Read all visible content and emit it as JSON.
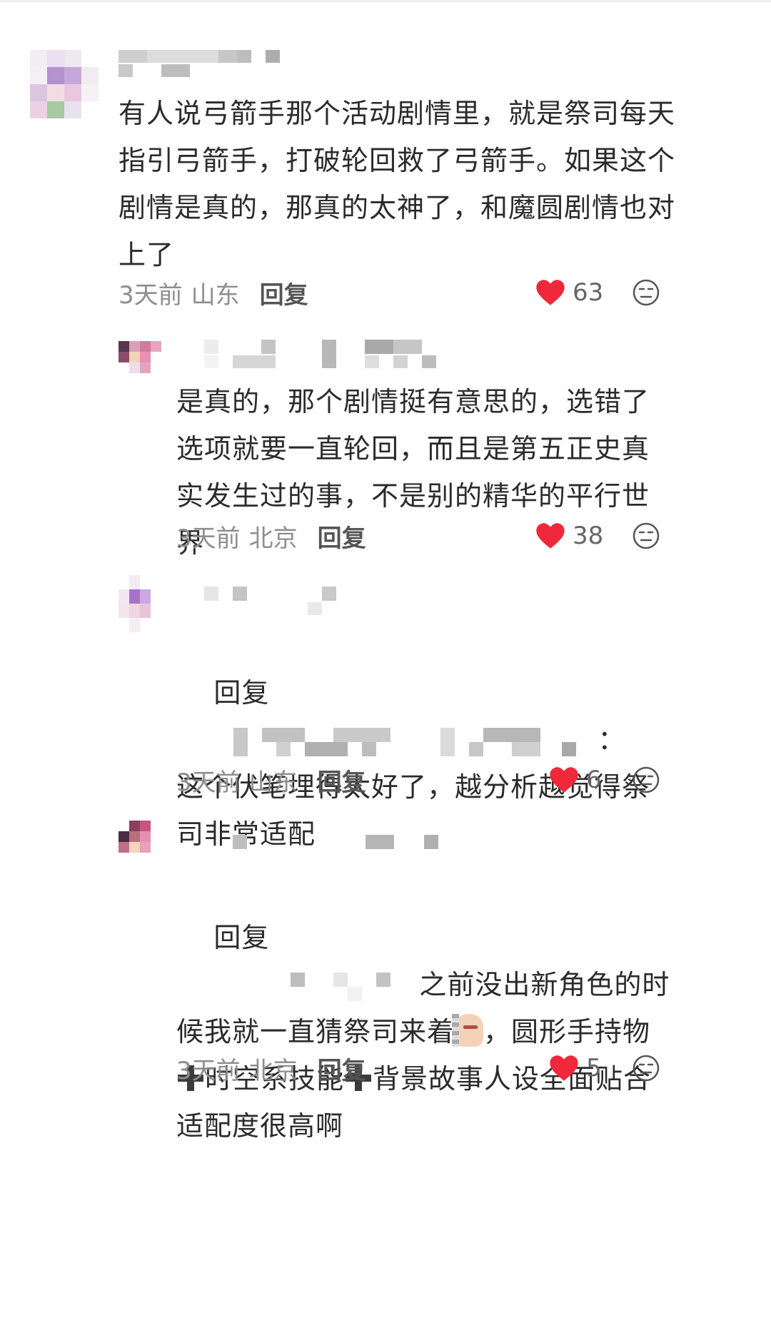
{
  "comments": [
    {
      "text": "有人说弓箭手那个活动剧情里，就是祭司每天指引弓箭手，打破轮回救了弓箭手。如果这个剧情是真的，那真的太神了，和魔圆剧情也对上了",
      "time": "3天前",
      "location": "山东",
      "reply_label": "回复",
      "likes": "63"
    },
    {
      "text": "是真的，那个剧情挺有意思的，选错了选项就要一直轮回，而且是第五正史真实发生过的事，不是别的精华的平行世界",
      "time": "3天前",
      "location": "北京",
      "reply_label": "回复",
      "likes": "38"
    },
    {
      "reply_prefix": "回复",
      "reply_colon": "：",
      "text": "这个伏笔埋得太好了，越分析越觉得祭司非常适配",
      "time": "3天前",
      "location": "山东",
      "reply_label": "回复",
      "likes": "6"
    },
    {
      "reply_prefix": "回复",
      "text_part1": "之前没出新角色的时候我就一直猜祭司来着",
      "text_part2": "，圆形手持物",
      "text_part3": "时空系技能",
      "text_part4": "背景故事人设全面贴合适配度很高啊",
      "time": "3天前",
      "location": "北京",
      "reply_label": "回复",
      "likes": "5"
    }
  ],
  "icons": {
    "like": "heart-icon",
    "dislike": "meh-face-icon",
    "plus": "heavy-plus-emoji",
    "inline_emoji": "peeking-face-sticker"
  },
  "colors": {
    "heart": "#f0283c",
    "text": "#2b2b2b",
    "meta": "#8e8e8e"
  }
}
